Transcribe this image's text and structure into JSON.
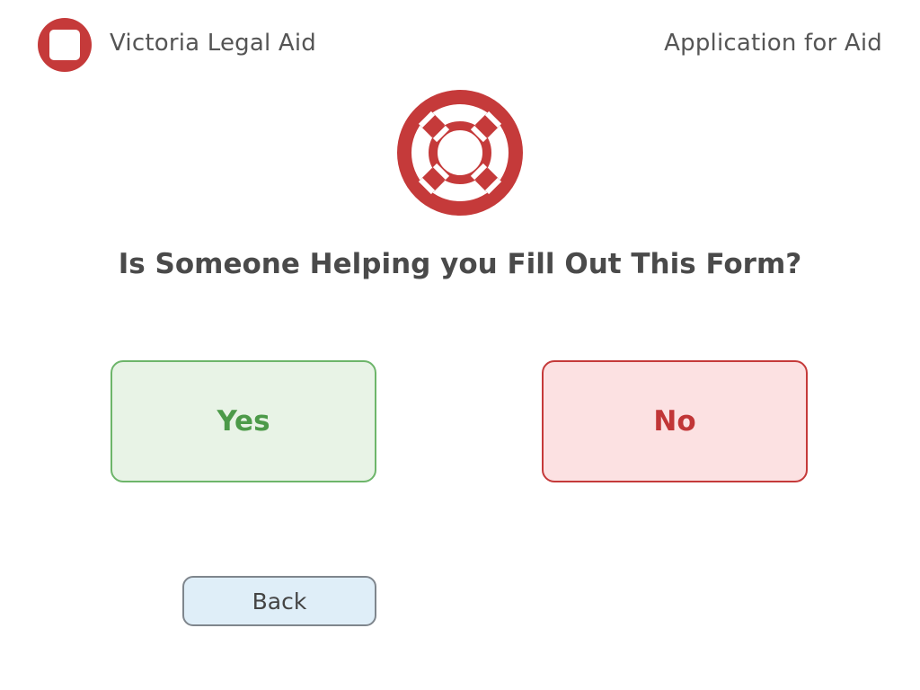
{
  "header": {
    "brand_name": "Victoria Legal Aid",
    "app_title": "Application for Aid",
    "logo_icon": "rounded-square-logo-icon"
  },
  "main": {
    "hero_icon": "lifebuoy-icon",
    "question": "Is Someone Helping you Fill Out This Form?",
    "yes_label": "Yes",
    "no_label": "No",
    "back_label": "Back"
  },
  "colors": {
    "brand_red": "#c53a3a",
    "yes_green": "#4c9a49",
    "yes_bg": "#e8f3e6",
    "no_bg": "#fce1e2",
    "back_bg": "#dfeef8"
  }
}
